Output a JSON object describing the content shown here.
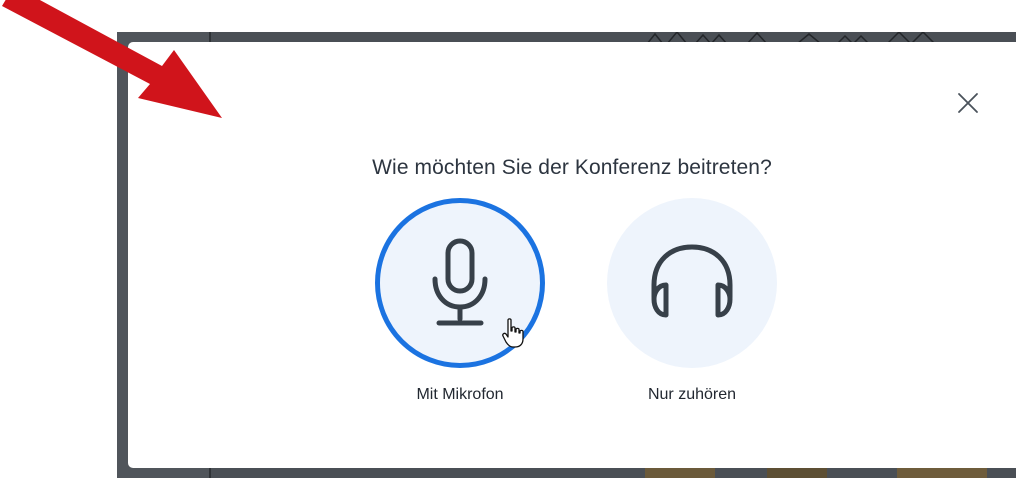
{
  "dialog": {
    "title": "Wie möchten Sie der Konferenz beitreten?",
    "close_icon": "close-icon",
    "options": [
      {
        "label": "Mit Mikrofon",
        "icon": "microphone-icon",
        "selected": true
      },
      {
        "label": "Nur zuhören",
        "icon": "headphones-icon",
        "selected": false
      }
    ]
  },
  "colors": {
    "accent": "#1b73e1",
    "circle_bg": "#eef4fc",
    "icon": "#374049",
    "backdrop": "#4a4f55",
    "annotation_arrow": "#d0141b"
  }
}
